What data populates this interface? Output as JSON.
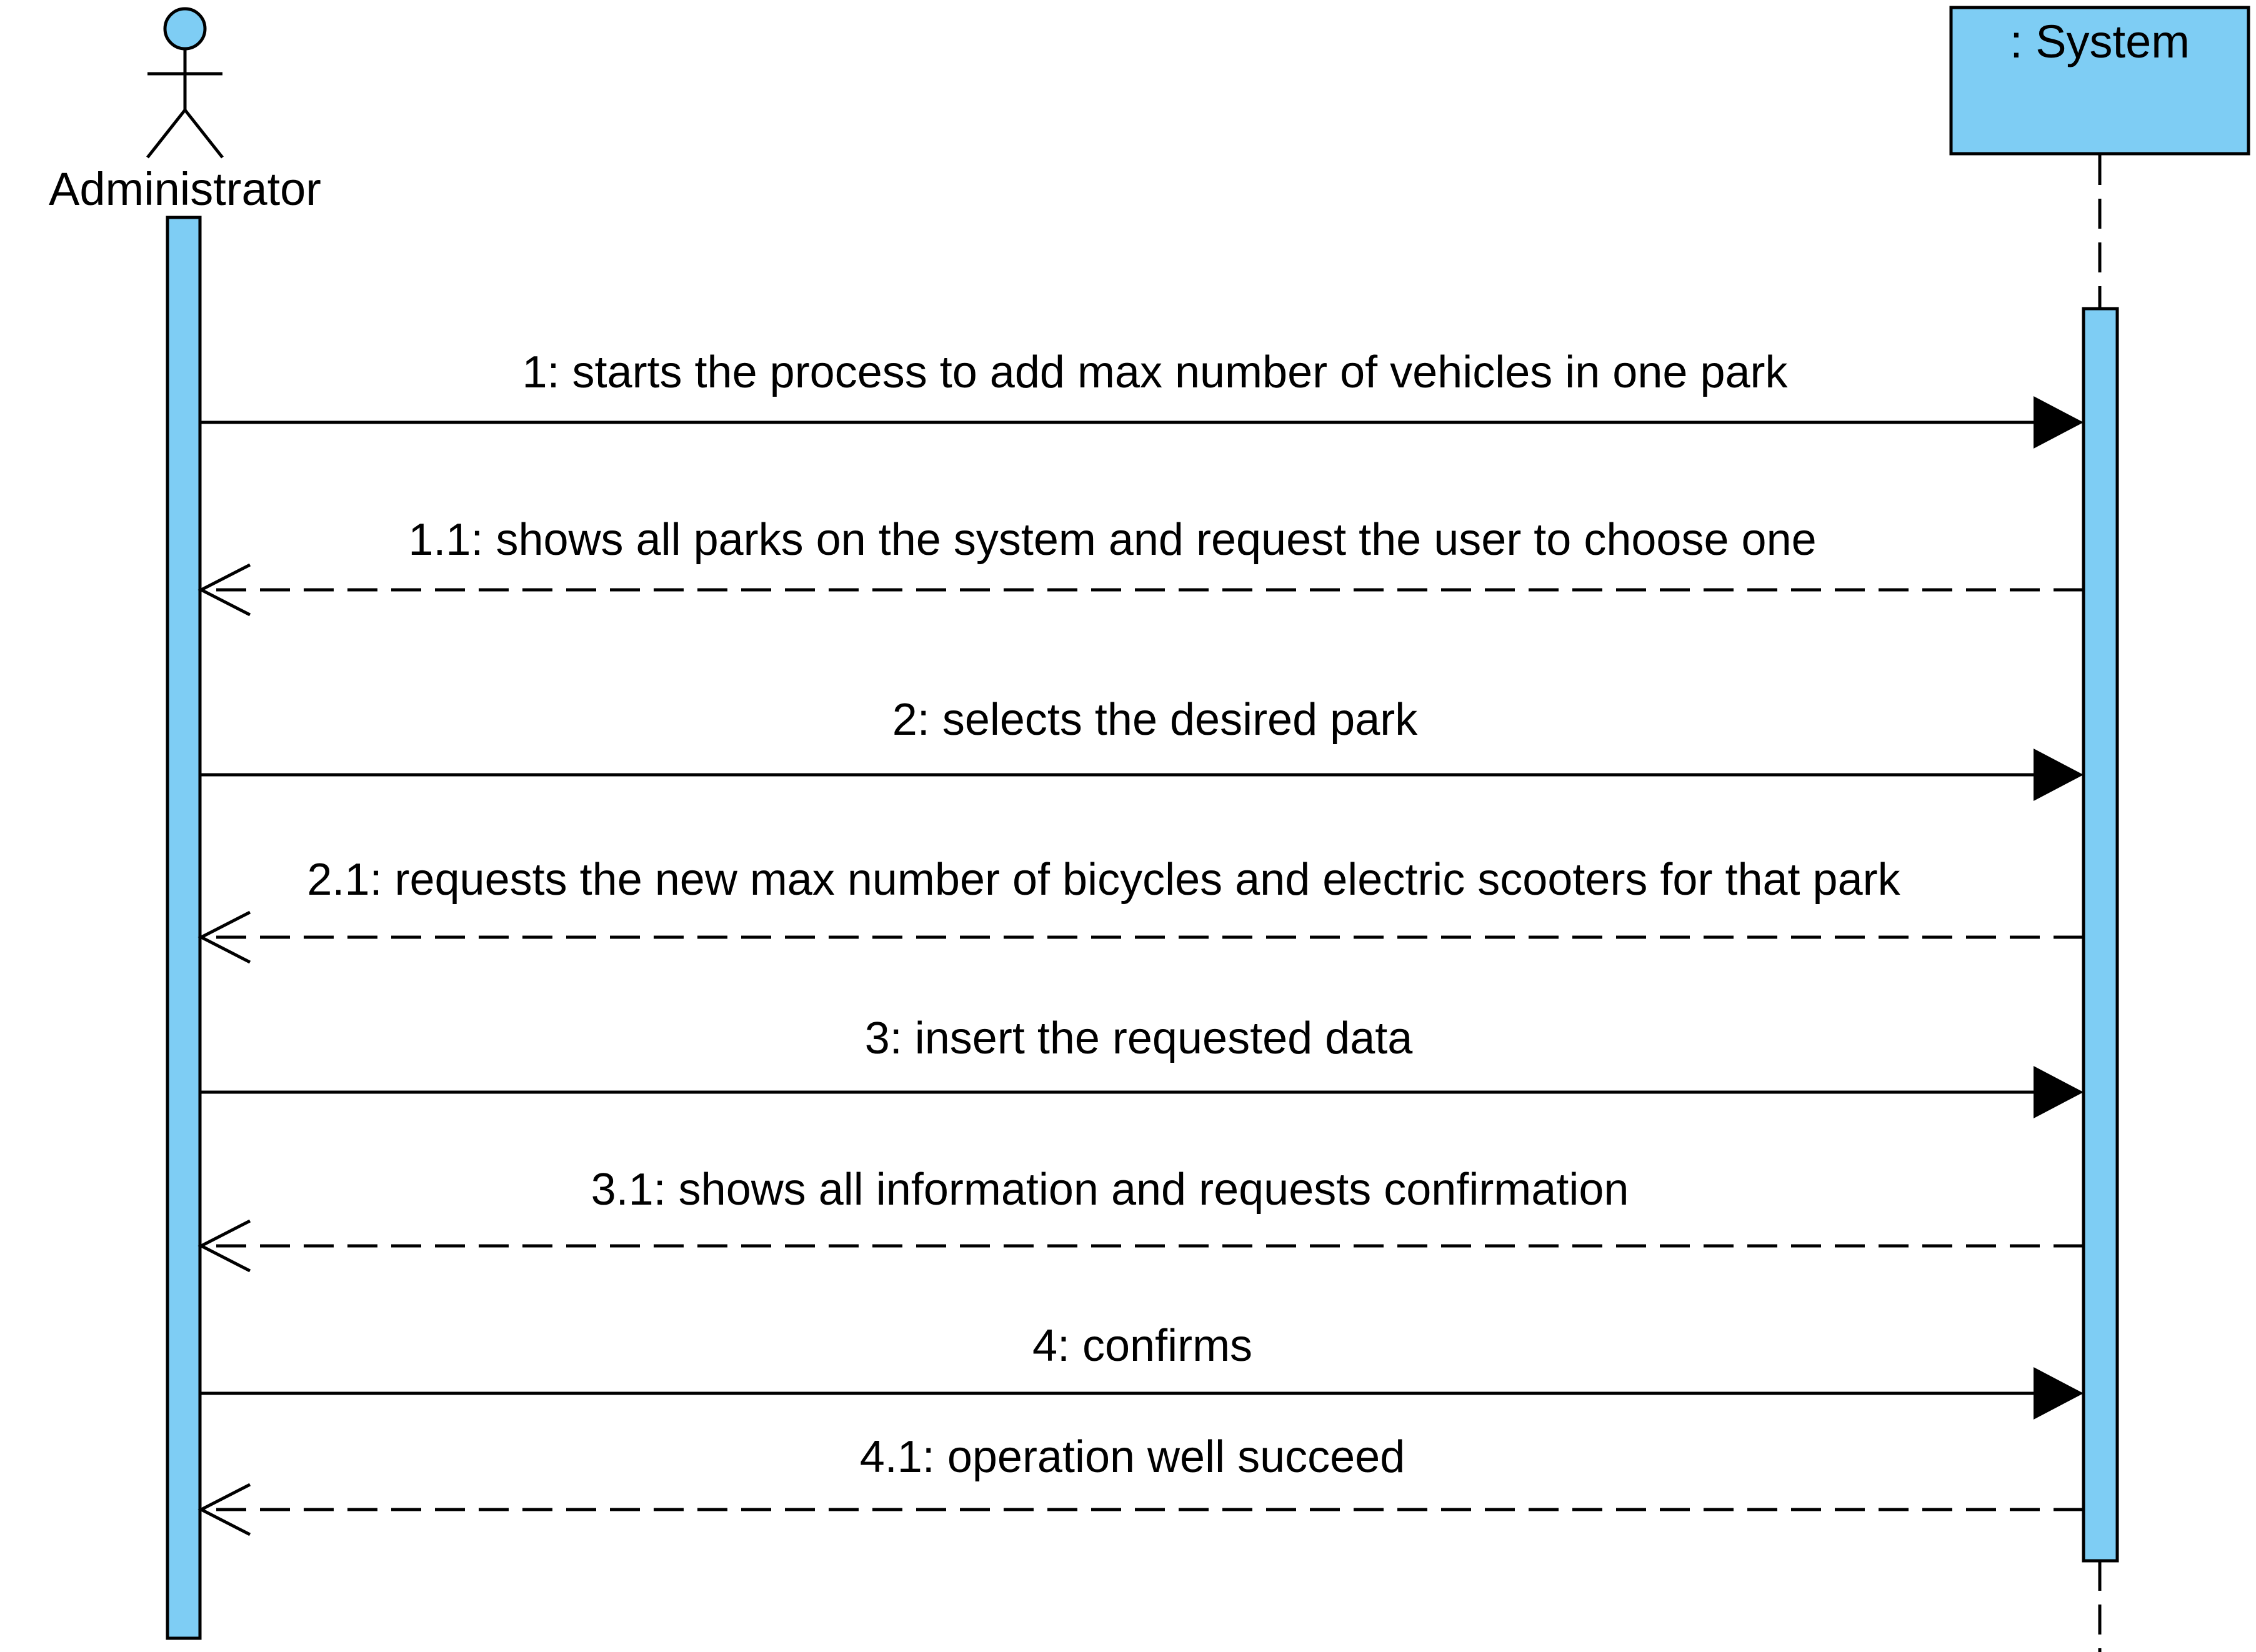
{
  "diagram": {
    "type": "sequence",
    "colors": {
      "fill": "#7ecdf4",
      "stroke": "#000000",
      "background": "#ffffff"
    },
    "participants": {
      "actor": {
        "name": "Administrator",
        "icon": "stick-figure-icon"
      },
      "system": {
        "name": ": System"
      }
    },
    "messages": [
      {
        "number": "1",
        "label": "1: starts the process to add max number of vehicles in one park",
        "kind": "sync",
        "direction": "actor-to-system"
      },
      {
        "number": "1.1",
        "label": "1.1: shows all parks on the system and request the user to choose one",
        "kind": "return",
        "direction": "system-to-actor"
      },
      {
        "number": "2",
        "label": "2: selects the desired park",
        "kind": "sync",
        "direction": "actor-to-system"
      },
      {
        "number": "2.1",
        "label": "2.1: requests the new max number of bicycles and electric scooters for that park",
        "kind": "return",
        "direction": "system-to-actor"
      },
      {
        "number": "3",
        "label": "3: insert the requested data",
        "kind": "sync",
        "direction": "actor-to-system"
      },
      {
        "number": "3.1",
        "label": "3.1: shows all information and requests confirmation",
        "kind": "return",
        "direction": "system-to-actor"
      },
      {
        "number": "4",
        "label": "4: confirms",
        "kind": "sync",
        "direction": "actor-to-system"
      },
      {
        "number": "4.1",
        "label": "4.1: operation well succeed",
        "kind": "return",
        "direction": "system-to-actor"
      }
    ]
  }
}
